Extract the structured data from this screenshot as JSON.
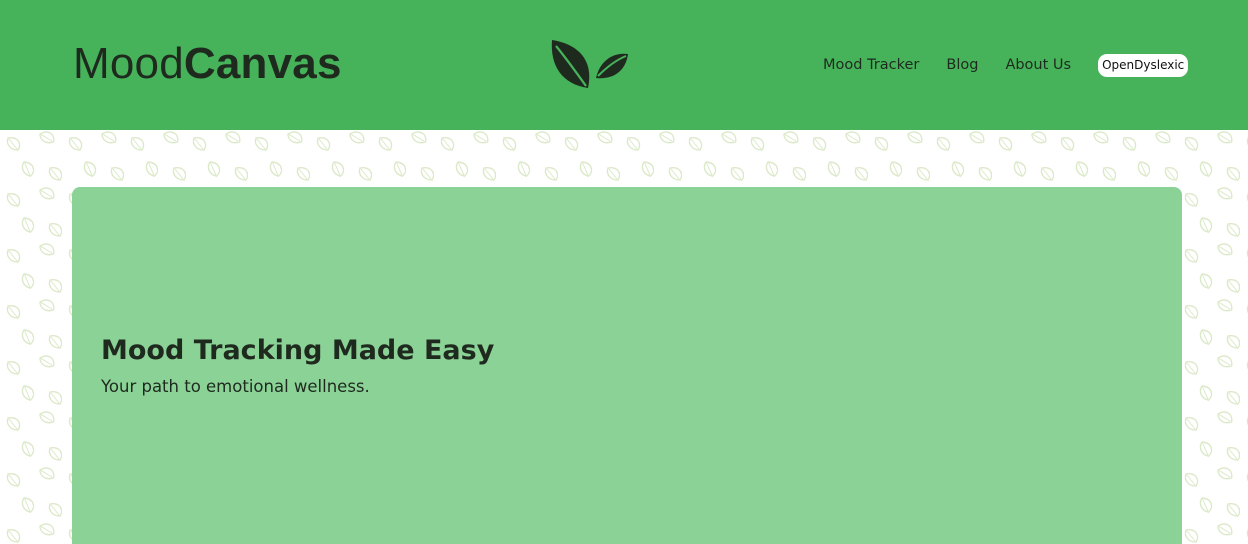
{
  "header": {
    "brand_light": "Mood",
    "brand_bold": "Canvas",
    "logo_icon": "two-leaves-icon",
    "background_color": "#46b35a"
  },
  "nav": {
    "items": [
      {
        "label": "Mood Tracker"
      },
      {
        "label": "Blog"
      },
      {
        "label": "About Us"
      }
    ],
    "font_toggle_label": "OpenDyslexic"
  },
  "hero": {
    "title_bold": "Mood",
    "title_rest": " Tracking Made Easy",
    "subtitle": "Your path to emotional wellness.",
    "background_color": "#8bd296"
  },
  "background_pattern_icon": "leaf-pattern-icon"
}
